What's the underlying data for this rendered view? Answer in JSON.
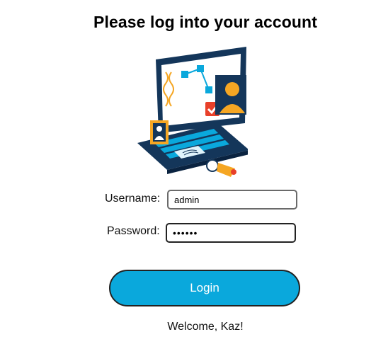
{
  "page": {
    "title": "Please log into your account"
  },
  "form": {
    "username_label": "Username:",
    "username_value": "admin",
    "password_label": "Password:",
    "password_value": "secret",
    "login_label": "Login"
  },
  "status": {
    "welcome": "Welcome, Kaz!"
  },
  "illustration": {
    "icon": "laptop-identity-verification-icon",
    "colors": {
      "navy": "#14365a",
      "blue": "#0aa8dc",
      "orange": "#f5a623",
      "red": "#e8402a"
    }
  }
}
